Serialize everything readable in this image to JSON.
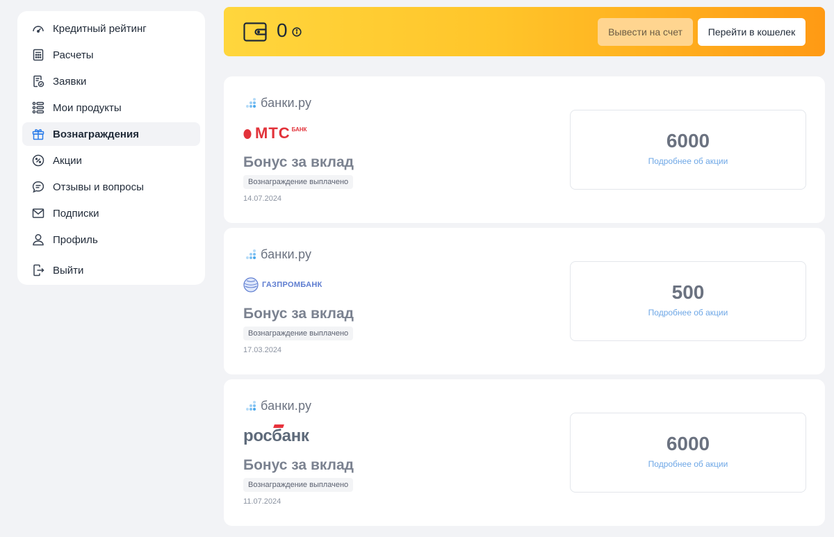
{
  "sidebar": {
    "items": [
      {
        "label": "Кредитный рейтинг",
        "icon": "speedometer-icon",
        "active": false
      },
      {
        "label": "Расчеты",
        "icon": "calculator-icon",
        "active": false
      },
      {
        "label": "Заявки",
        "icon": "application-icon",
        "active": false
      },
      {
        "label": "Мои продукты",
        "icon": "list-icon",
        "active": false
      },
      {
        "label": "Вознаграждения",
        "icon": "gift-icon",
        "active": true
      },
      {
        "label": "Акции",
        "icon": "percent-icon",
        "active": false
      },
      {
        "label": "Отзывы и вопросы",
        "icon": "chat-icon",
        "active": false
      },
      {
        "label": "Подписки",
        "icon": "mail-icon",
        "active": false
      },
      {
        "label": "Профиль",
        "icon": "user-icon",
        "active": false
      },
      {
        "label": "Выйти",
        "icon": "logout-icon",
        "active": false
      }
    ]
  },
  "wallet": {
    "balance": "0",
    "withdraw_label": "Вывести на счет",
    "go_wallet_label": "Перейти в кошелек"
  },
  "rewards": [
    {
      "source": "банки.ру",
      "bank": "МТС",
      "bank_suffix": "БАНК",
      "title": "Бонус за вклад",
      "status": "Вознаграждение выплачено",
      "date": "14.07.2024",
      "amount": "6000",
      "more": "Подробнее об акции"
    },
    {
      "source": "банки.ру",
      "bank": "ГАЗПРОМБАНК",
      "title": "Бонус за вклад",
      "status": "Вознаграждение выплачено",
      "date": "17.03.2024",
      "amount": "500",
      "more": "Подробнее об акции"
    },
    {
      "source": "банки.ру",
      "bank": "росбанк",
      "title": "Бонус за вклад",
      "status": "Вознаграждение выплачено",
      "date": "11.07.2024",
      "amount": "6000",
      "more": "Подробнее об акции"
    }
  ],
  "colors": {
    "accent": "#2b7de9",
    "wallet_gradient_start": "#ffd63d",
    "wallet_gradient_end": "#ff9a14",
    "mts_red": "#e2323a",
    "gazprom_blue": "#5d7cd0",
    "rosbank_red": "#e8323c"
  }
}
